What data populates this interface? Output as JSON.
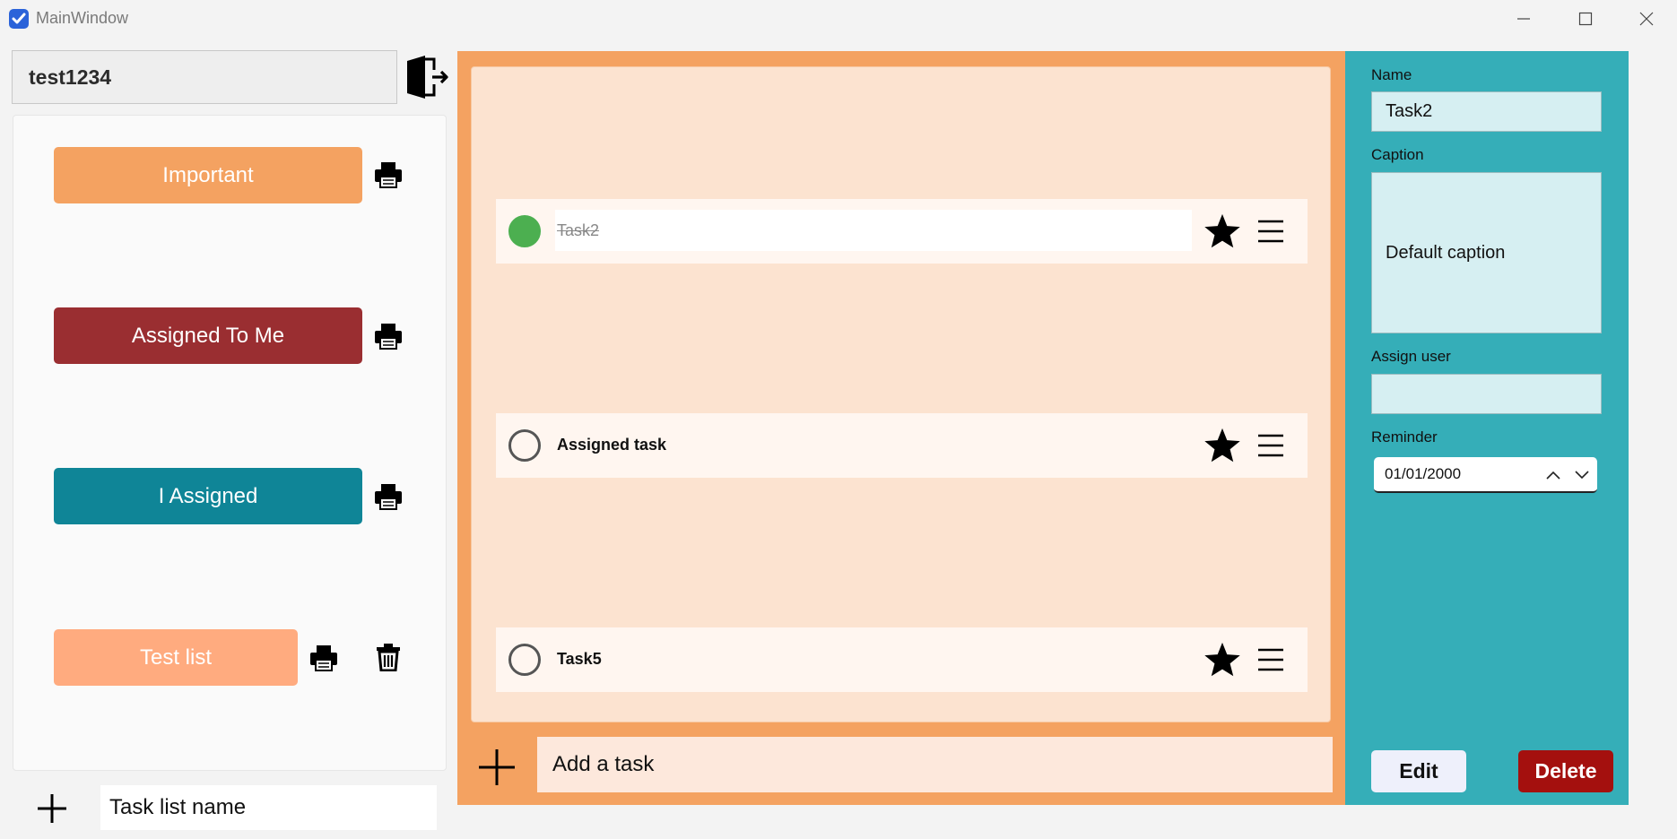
{
  "window": {
    "title": "MainWindow",
    "app_icon": "checkbox-check-icon",
    "controls": [
      "minimize-icon",
      "maximize-icon",
      "close-icon"
    ]
  },
  "user": {
    "name": "test1234",
    "logout_icon": "logout-door-icon"
  },
  "task_lists": [
    {
      "label": "Important",
      "color": "#f4a261",
      "icons": [
        "printer-icon"
      ]
    },
    {
      "label": "Assigned To Me",
      "color": "#9a2e31",
      "icons": [
        "printer-icon"
      ]
    },
    {
      "label": "I Assigned",
      "color": "#0f8597",
      "icons": [
        "printer-icon"
      ]
    },
    {
      "label": "Test list",
      "color": "#ffab7f",
      "icons": [
        "printer-icon",
        "trash-icon"
      ]
    }
  ],
  "new_list": {
    "placeholder": "Task list name",
    "add_icon": "plus-icon"
  },
  "tasks": [
    {
      "title": "Task2",
      "completed": true,
      "important": true
    },
    {
      "title": "Assigned task",
      "completed": false,
      "important": true
    },
    {
      "title": "Task5",
      "completed": false,
      "important": true
    }
  ],
  "task_row_icons": [
    "star-icon",
    "hamburger-menu-icon"
  ],
  "new_task": {
    "placeholder": "Add a task",
    "add_icon": "plus-icon"
  },
  "details": {
    "name_label": "Name",
    "name_value": "Task2",
    "caption_label": "Caption",
    "caption_value": "Default caption",
    "assign_label": "Assign user",
    "assign_value": "",
    "reminder_label": "Reminder",
    "reminder_value": "01/01/2000",
    "edit_label": "Edit",
    "delete_label": "Delete"
  },
  "colors": {
    "center_accent": "#f4a261",
    "details_accent": "#35aeb8",
    "delete": "#a4100e",
    "completed_check": "#4caf50"
  }
}
